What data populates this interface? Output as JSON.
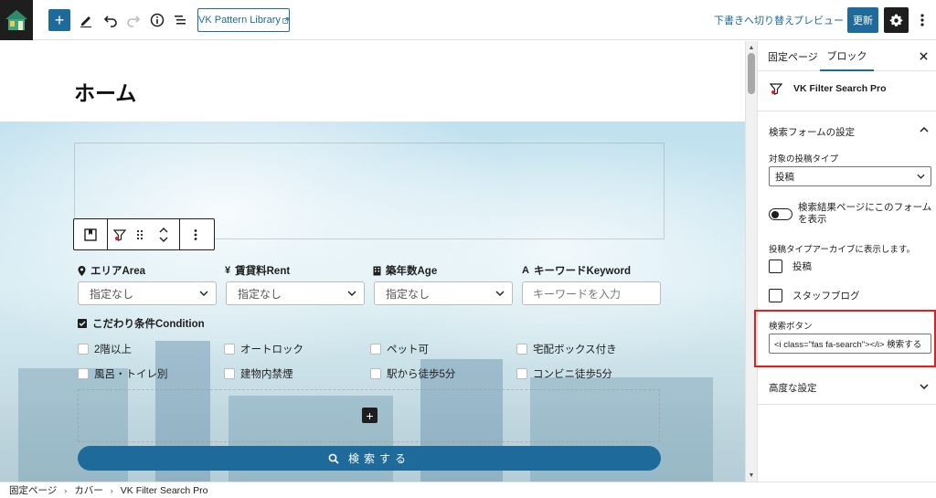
{
  "toolbar": {
    "pattern_library_label": "VK Pattern Library",
    "switch_to_draft_label": "下書きへ切り替え",
    "preview_label": "プレビュー",
    "update_label": "更新"
  },
  "editor": {
    "page_title": "ホーム"
  },
  "filter_form": {
    "fields": [
      {
        "label": "エリアArea",
        "icon": "location-pin-icon",
        "placeholder": "指定なし"
      },
      {
        "label": "賃貸料Rent",
        "icon": "yen-icon",
        "placeholder": "指定なし"
      },
      {
        "label": "築年数Age",
        "icon": "building-icon",
        "placeholder": "指定なし"
      },
      {
        "label": "キーワードKeyword",
        "icon": "font-icon",
        "placeholder": "キーワードを入力"
      }
    ],
    "condition_title": "こだわり条件Condition",
    "conditions": [
      "2階以上",
      "オートロック",
      "ペット可",
      "宅配ボックス付き",
      "風呂・トイレ別",
      "建物内禁煙",
      "駅から徒歩5分",
      "コンビニ徒歩5分"
    ],
    "search_button_label": "検索する"
  },
  "sidebar": {
    "tabs": [
      "固定ページ",
      "ブロック"
    ],
    "active_tab": "ブロック",
    "block_name": "VK Filter Search Pro",
    "panel_search_form_title": "検索フォームの設定",
    "post_type_label": "対象の投稿タイプ",
    "post_type_value": "投稿",
    "toggle_label": "検索結果ページにこのフォームを表示",
    "archive_label": "投稿タイプアーカイブに表示します。",
    "archive_options": [
      "投稿",
      "スタッフブログ"
    ],
    "search_button_field_label": "検索ボタン",
    "search_button_field_value": "<i class=\"fas fa-search\"></i> 検索する",
    "advanced_title": "高度な設定"
  },
  "breadcrumb": [
    "固定ページ",
    "カバー",
    "VK Filter Search Pro"
  ],
  "colors": {
    "accent": "#1d6a9b",
    "dark": "#1e1e1e",
    "highlight": "#e02020"
  }
}
